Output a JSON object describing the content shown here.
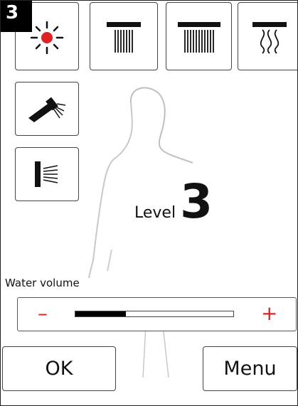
{
  "screen_badge": "3",
  "modes": [
    {
      "icon": "sun-icon"
    },
    {
      "icon": "rain-shower-narrow-icon"
    },
    {
      "icon": "rain-shower-wide-icon"
    },
    {
      "icon": "massage-shower-icon"
    },
    {
      "icon": "hand-shower-icon"
    },
    {
      "icon": "side-jet-icon"
    }
  ],
  "level": {
    "label": "Level",
    "value": "3"
  },
  "water_volume": {
    "label": "Water volume",
    "minus": "–",
    "plus": "+",
    "fraction": 0.32,
    "accent": "#dd2222"
  },
  "actions": {
    "ok": "OK",
    "menu": "Menu"
  }
}
